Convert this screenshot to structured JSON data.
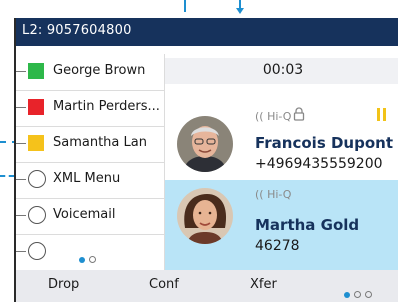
{
  "status_bar": {
    "line_label": "L2: 9057604800"
  },
  "line_keys": [
    {
      "label": "George Brown",
      "indicator": "presence-available",
      "color": "#2eb84a"
    },
    {
      "label": "Martin Perders...",
      "indicator": "presence-busy",
      "color": "#e8232a"
    },
    {
      "label": "Samantha Lan",
      "indicator": "presence-away",
      "color": "#f5c21b"
    },
    {
      "label": "XML Menu",
      "indicator": "circle"
    },
    {
      "label": "Voicemail",
      "indicator": "circle"
    },
    {
      "label": "",
      "indicator": "circle"
    }
  ],
  "line_keys_pager": {
    "pages": 2,
    "current": 1
  },
  "call_timer": "00:03",
  "calls": [
    {
      "codec": "Hi-Q",
      "name": "Francois Dupont",
      "number": "+4969435559200",
      "secure": true,
      "on_hold": true,
      "active": false
    },
    {
      "codec": "Hi-Q",
      "name": "Martha Gold",
      "number": "46278",
      "secure": false,
      "on_hold": false,
      "active": true
    }
  ],
  "softkeys": [
    "Drop",
    "Conf",
    "Xfer"
  ],
  "softkey_pager": {
    "pages": 3,
    "current": 1
  },
  "colors": {
    "status_bar": "#16325c",
    "accent": "#1e8fd0",
    "active_call": "#b9e4f7",
    "hold": "#f2c318"
  }
}
